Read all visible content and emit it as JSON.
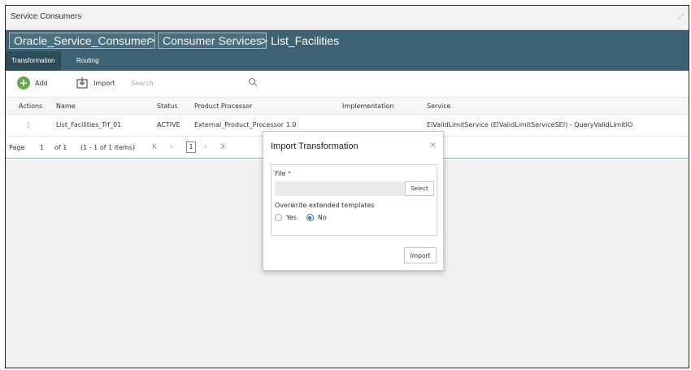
{
  "window": {
    "title": "Service Consumers"
  },
  "breadcrumb": {
    "items": [
      "Oracle_Service_Consumer",
      "Consumer Services"
    ],
    "separator": ">",
    "current": "> List_Facilities"
  },
  "tabs": [
    {
      "label": "Transformation",
      "active": true
    },
    {
      "label": "Routing",
      "active": false
    }
  ],
  "toolbar": {
    "add_label": "Add",
    "import_label": "Import",
    "search_placeholder": "Search"
  },
  "table": {
    "headers": [
      "Actions",
      "Name",
      "Status",
      "Product Processor",
      "Implementation",
      "Service"
    ],
    "rows": [
      {
        "actions": "⋮",
        "name": "List_Facilities_Trf_01",
        "status": "ACTIVE",
        "product_processor": "External_Product_Processor 1.0",
        "implementation": "",
        "service": "ElValidLimitService (ElValidLimitServiceSEI) - QueryValidLimitIO"
      }
    ]
  },
  "pager": {
    "page_label": "Page",
    "page_number": "1",
    "of_label": "of 1",
    "items_label": "(1 - 1 of 1 items)",
    "current_page": "1"
  },
  "modal": {
    "title": "Import Transformation",
    "close_icon": "×",
    "file_label": "File",
    "required_mark": "*",
    "select_label": "Select",
    "overwrite_label": "Overwrite extended templates",
    "option_yes": "Yes",
    "option_no": "No",
    "selected_option": "No",
    "import_label": "Import"
  },
  "colors": {
    "nav_bg": "#3d6273",
    "tab_active_bg": "#2e4d5b",
    "accent_blue": "#2a6fd4",
    "add_green": "#6aa84f"
  }
}
